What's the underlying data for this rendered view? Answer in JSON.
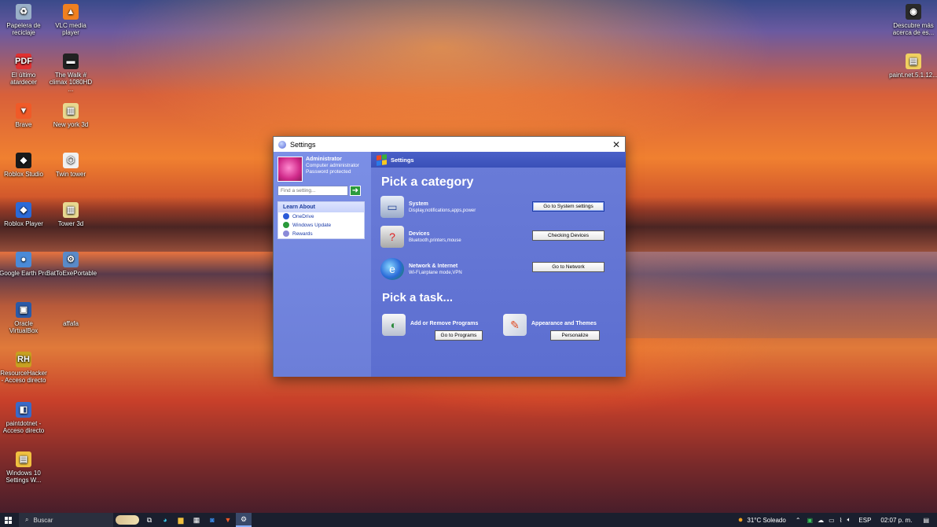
{
  "desktop": {
    "left_col1": [
      {
        "label": "Papelera de reciclaje",
        "icon": "recycle-bin-icon",
        "color": "#9ab0c8",
        "glyph": "♻"
      },
      {
        "label": "El último atardecer",
        "icon": "pdf-icon",
        "color": "#e03030",
        "glyph": "PDF"
      },
      {
        "label": "Brave",
        "icon": "brave-icon",
        "color": "#f05a28",
        "glyph": "▼"
      },
      {
        "label": "Roblox Studio",
        "icon": "roblox-studio-icon",
        "color": "#1a1a1a",
        "glyph": "◆"
      },
      {
        "label": "Roblox Player",
        "icon": "roblox-player-icon",
        "color": "#2a6ad8",
        "glyph": "◆"
      },
      {
        "label": "Google Earth Pro",
        "icon": "google-earth-icon",
        "color": "#4a8ad8",
        "glyph": "●"
      },
      {
        "label": "Oracle VirtualBox",
        "icon": "virtualbox-icon",
        "color": "#2a5aa8",
        "glyph": "▣"
      },
      {
        "label": "ResourceHacker - Acceso directo",
        "icon": "resourcehacker-icon",
        "color": "#c8a020",
        "glyph": "RH"
      },
      {
        "label": "paintdotnet - Acceso directo",
        "icon": "paintdotnet-icon",
        "color": "#3a6ac8",
        "glyph": "◧"
      },
      {
        "label": "Windows 10 Settings W...",
        "icon": "folder-icon",
        "color": "#f0c040",
        "glyph": "▤"
      }
    ],
    "left_col2": [
      {
        "label": "VLC media player",
        "icon": "vlc-icon",
        "color": "#f08020",
        "glyph": "▲"
      },
      {
        "label": "The Walk # climax 1080HD ...",
        "icon": "video-file-icon",
        "color": "#222222",
        "glyph": "▬"
      },
      {
        "label": "New york 3d",
        "icon": "3d-file-icon",
        "color": "#e8d890",
        "glyph": "▥"
      },
      {
        "label": "Twin tower",
        "icon": "3d-object-icon",
        "color": "#f0f0f0",
        "glyph": "⬡"
      },
      {
        "label": "Tower 3d",
        "icon": "3d-file-icon",
        "color": "#e8d890",
        "glyph": "▥"
      },
      {
        "label": "BatToExePortable",
        "icon": "battoexe-icon",
        "color": "#5a8ac8",
        "glyph": "⚙"
      },
      {
        "label": "affafa",
        "icon": "blank-file-icon",
        "color": "transparent",
        "glyph": ""
      }
    ],
    "right_icons": [
      {
        "label": "Descubre más acerca de es...",
        "icon": "camera-icon",
        "color": "#2a2a2a",
        "glyph": "◉"
      },
      {
        "label": "paint.net.5.1.12...",
        "icon": "folder-zip-icon",
        "color": "#f0d060",
        "glyph": "▤"
      }
    ]
  },
  "window": {
    "title": "Settings",
    "close_glyph": "✕",
    "user": {
      "name": "Administrator",
      "role": "Computer administrator",
      "status": "Password protected"
    },
    "search_placeholder": "Find a setting...",
    "learn_about": {
      "heading": "Learn About",
      "items": [
        {
          "label": "OneDrive",
          "icon": "help-icon",
          "color": "#2a5ad8"
        },
        {
          "label": "Windows Update",
          "icon": "windows-update-icon",
          "color": "#2a9a3a"
        },
        {
          "label": "Rewards",
          "icon": "rewards-icon",
          "color": "#8a8ad8"
        }
      ]
    },
    "header": "Settings",
    "pick_category": "Pick a category",
    "categories": [
      {
        "name": "System",
        "desc": "Display,notifications,apps,power",
        "button": "Go to System settings",
        "icon": "computer-icon"
      },
      {
        "name": "Devices",
        "desc": "Bluetooth,printers,mouse",
        "button": "Checking Devices",
        "icon": "printer-icon"
      },
      {
        "name": "Network & Internet",
        "desc": "Wi-Fi,airplane mode,VPN",
        "button": "Go to Network",
        "icon": "globe-icon"
      }
    ],
    "pick_task": "Pick a task...",
    "tasks": [
      {
        "name": "Add or Remove Programs",
        "button": "Go to Programs",
        "icon": "programs-icon"
      },
      {
        "name": "Appearance and Themes",
        "button": "Personalize",
        "icon": "themes-icon"
      }
    ]
  },
  "taskbar": {
    "search_label": "Buscar",
    "weather": "31°C  Soleado",
    "language": "ESP",
    "clock": "02:07 p. m."
  }
}
